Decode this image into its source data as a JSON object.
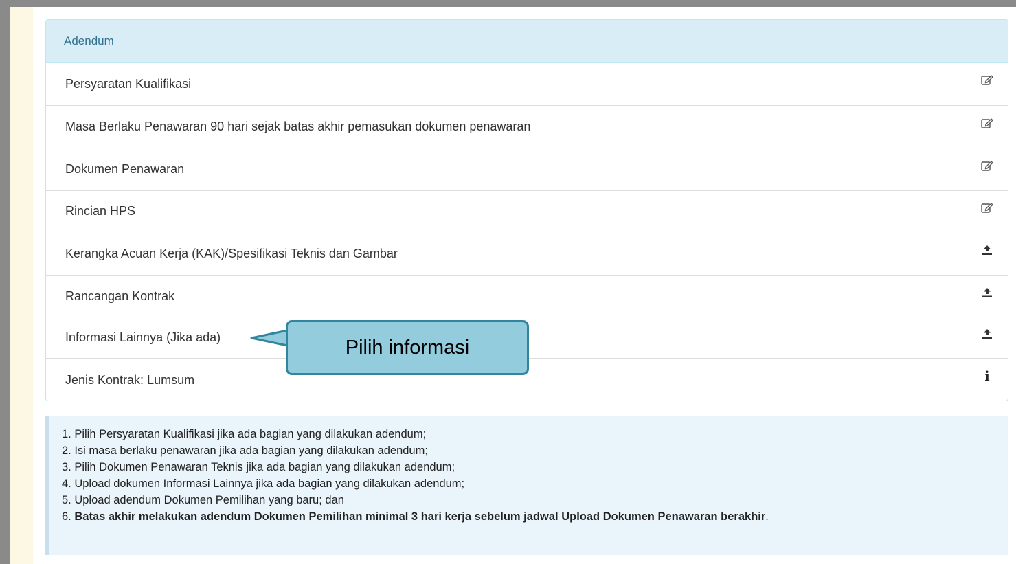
{
  "panel": {
    "heading": "Adendum",
    "items": [
      {
        "label": "Persyaratan Kualifikasi",
        "icon": "edit-icon"
      },
      {
        "label": "Masa Berlaku Penawaran 90 hari sejak batas akhir pemasukan dokumen penawaran",
        "icon": "edit-icon"
      },
      {
        "label": "Dokumen Penawaran",
        "icon": "edit-icon"
      },
      {
        "label": "Rincian HPS",
        "icon": "edit-icon"
      },
      {
        "label": "Kerangka Acuan Kerja (KAK)/Spesifikasi Teknis dan Gambar",
        "icon": "upload-icon"
      },
      {
        "label": "Rancangan Kontrak",
        "icon": "upload-icon"
      },
      {
        "label": "Informasi Lainnya (Jika ada)",
        "icon": "upload-icon"
      },
      {
        "label": "Jenis Kontrak: Lumsum",
        "icon": "info-icon"
      }
    ]
  },
  "callout": {
    "text": "Pilih informasi"
  },
  "notes": {
    "items": [
      "1. Pilih Persyaratan Kualifikasi jika ada bagian yang dilakukan adendum;",
      "2. Isi masa berlaku penawaran jika ada bagian yang dilakukan adendum;",
      "3. Pilih Dokumen Penawaran Teknis jika ada bagian yang dilakukan adendum;",
      "4. Upload dokumen Informasi Lainnya jika ada bagian yang dilakukan adendum;",
      "5. Upload adendum Dokumen Pemilihan yang baru; dan"
    ],
    "last_prefix": "6. ",
    "last_bold": "Batas akhir melakukan adendum Dokumen Pemilihan minimal 3 hari kerja sebelum jadwal Upload Dokumen Penawaran berakhir",
    "last_suffix": "."
  },
  "colors": {
    "heading_bg": "#d9edf7",
    "heading_text": "#31708f",
    "callout_fill": "#93cddd",
    "callout_border": "#31859c",
    "notes_bg": "#eaf4fb",
    "left_strip": "#fcf8e3"
  }
}
